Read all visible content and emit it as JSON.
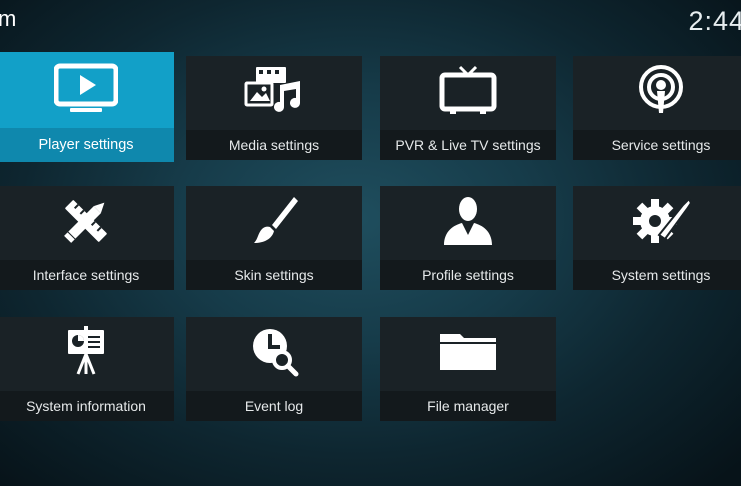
{
  "header": {
    "title": "m",
    "clock": "2:44"
  },
  "tiles": [
    {
      "label": "Player settings",
      "icon": "player-screen-icon",
      "focused": true
    },
    {
      "label": "Media settings",
      "icon": "media-icon"
    },
    {
      "label": "PVR & Live TV settings",
      "icon": "tv-icon"
    },
    {
      "label": "Service settings",
      "icon": "broadcast-icon"
    },
    {
      "label": "Interface settings",
      "icon": "pencil-ruler-icon"
    },
    {
      "label": "Skin settings",
      "icon": "paintbrush-icon"
    },
    {
      "label": "Profile settings",
      "icon": "profile-icon"
    },
    {
      "label": "System settings",
      "icon": "gear-wrench-icon"
    },
    {
      "label": "System information",
      "icon": "presentation-board-icon"
    },
    {
      "label": "Event log",
      "icon": "clock-search-icon"
    },
    {
      "label": "File manager",
      "icon": "folder-icon"
    }
  ],
  "colors": {
    "accent": "#12a0c8",
    "tile": "#1a2226",
    "tile_label_bar": "#13191c"
  }
}
